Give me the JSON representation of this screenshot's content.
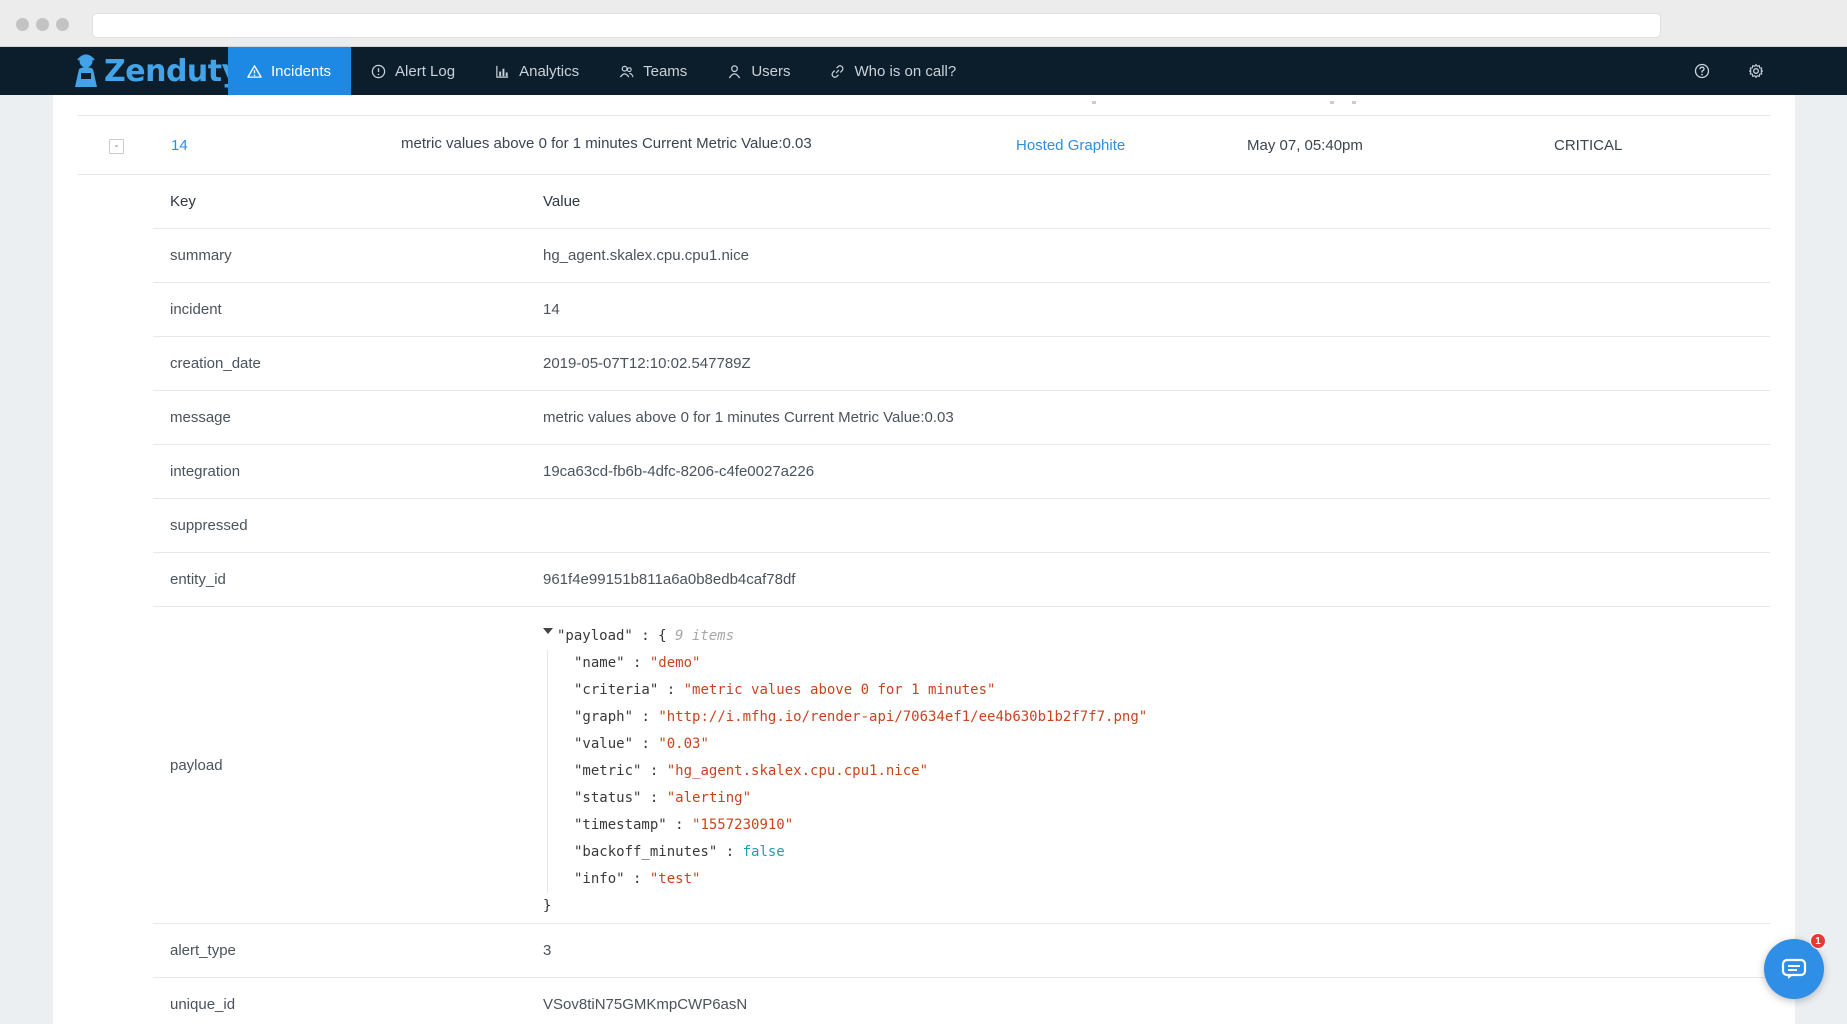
{
  "app": {
    "brand": "Zenduty"
  },
  "nav": {
    "items": [
      {
        "label": "Incidents",
        "icon": "warning-triangle-icon",
        "active": true
      },
      {
        "label": "Alert Log",
        "icon": "info-circle-icon",
        "active": false
      },
      {
        "label": "Analytics",
        "icon": "bar-chart-icon",
        "active": false
      },
      {
        "label": "Teams",
        "icon": "team-icon",
        "active": false
      },
      {
        "label": "Users",
        "icon": "user-icon",
        "active": false
      },
      {
        "label": "Who is on call?",
        "icon": "link-icon",
        "active": false
      }
    ],
    "right_icons": [
      "help-circle-icon",
      "gear-icon"
    ]
  },
  "incident": {
    "collapse_symbol": "-",
    "number": "14",
    "message": "metric values above 0 for 1 minutes Current Metric Value:0.03",
    "integration": "Hosted Graphite",
    "date": "May 07, 05:40pm",
    "urgency": "CRITICAL"
  },
  "details": {
    "header": {
      "key": "Key",
      "value": "Value"
    },
    "rows": [
      {
        "key": "summary",
        "value": "hg_agent.skalex.cpu.cpu1.nice"
      },
      {
        "key": "incident",
        "value": "14"
      },
      {
        "key": "creation_date",
        "value": "2019-05-07T12:10:02.547789Z"
      },
      {
        "key": "message",
        "value": "metric values above 0 for 1 minutes Current Metric Value:0.03"
      },
      {
        "key": "integration",
        "value": "19ca63cd-fb6b-4dfc-8206-c4fe0027a226"
      },
      {
        "key": "suppressed",
        "value": ""
      },
      {
        "key": "entity_id",
        "value": "961f4e99151b811a6a0b8edb4caf78df"
      }
    ],
    "payload": {
      "key": "payload",
      "root_key": "\"payload\"",
      "item_count": "9 items",
      "fields": [
        {
          "k": "\"name\"",
          "v": "\"demo\"",
          "kind": "string"
        },
        {
          "k": "\"criteria\"",
          "v": "\"metric values above 0 for 1 minutes\"",
          "kind": "string"
        },
        {
          "k": "\"graph\"",
          "v": "\"http://i.mfhg.io/render-api/70634ef1/ee4b630b1b2f7f7.png\"",
          "kind": "string"
        },
        {
          "k": "\"value\"",
          "v": "\"0.03\"",
          "kind": "string"
        },
        {
          "k": "\"metric\"",
          "v": "\"hg_agent.skalex.cpu.cpu1.nice\"",
          "kind": "string"
        },
        {
          "k": "\"status\"",
          "v": "\"alerting\"",
          "kind": "string"
        },
        {
          "k": "\"timestamp\"",
          "v": "\"1557230910\"",
          "kind": "string"
        },
        {
          "k": "\"backoff_minutes\"",
          "v": "false",
          "kind": "bool"
        },
        {
          "k": "\"info\"",
          "v": "\"test\"",
          "kind": "string"
        }
      ]
    },
    "after_rows": [
      {
        "key": "alert_type",
        "value": "3"
      },
      {
        "key": "unique_id",
        "value": "VSov8tiN75GMKmpCWP6asN"
      }
    ]
  },
  "chat": {
    "badge": "1",
    "icon": "chat-icon"
  },
  "colors": {
    "navbar": "#0c1d2b",
    "accent": "#1e88e5",
    "link": "#2f8ee0",
    "json_string": "#c9441f",
    "json_bool": "#1f9bb0"
  }
}
